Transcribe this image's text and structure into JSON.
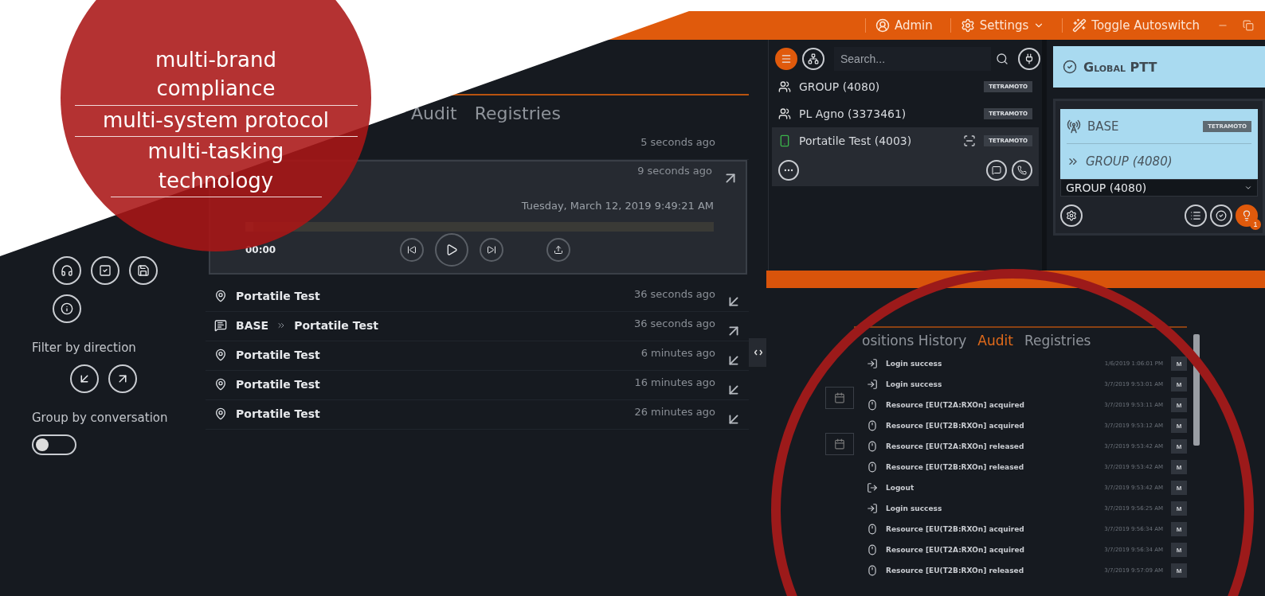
{
  "promo": {
    "lines": [
      "multi-brand\ncompliance",
      "multi-system protocol",
      "multi-tasking\ntechnology"
    ]
  },
  "title_bar": {
    "user": "Admin",
    "settings": "Settings",
    "autoswitch": "Toggle Autoswitch"
  },
  "left_panel": {
    "filter_label": "Filter by direction",
    "group_label": "Group by conversation",
    "group_toggle": {
      "on": false
    }
  },
  "history": {
    "tabs": [
      {
        "label": "Audit",
        "selected": false
      },
      {
        "label": "Registries",
        "selected": false
      }
    ],
    "events": [
      {
        "kind": "call",
        "time": "5 seconds ago"
      },
      {
        "kind": "call",
        "time": "9 seconds ago",
        "incoming": false,
        "player": {
          "date": "Tuesday, March 12, 2019 9:49:21 AM",
          "position": "00:00",
          "level": 0.0
        }
      },
      {
        "kind": "position",
        "target": "Portatile Test",
        "time": "36 seconds ago",
        "incoming": true
      },
      {
        "kind": "message",
        "source": "BASE",
        "target": "Portatile Test",
        "time": "36 seconds ago",
        "incoming": false
      },
      {
        "kind": "position",
        "target": "Portatile Test",
        "time": "6 minutes ago",
        "incoming": true
      },
      {
        "kind": "position",
        "target": "Portatile Test",
        "time": "16 minutes ago",
        "incoming": true
      },
      {
        "kind": "position",
        "target": "Portatile Test",
        "time": "26 minutes ago",
        "incoming": true
      }
    ]
  },
  "contacts": {
    "search": {
      "placeholder": "Search..."
    },
    "items": [
      {
        "kind": "group",
        "name": "GROUP (4080)",
        "tag": "TETRAMOTO",
        "selected": false
      },
      {
        "kind": "group",
        "name": "PL Agno (3373461)",
        "tag": "TETRAMOTO",
        "selected": false
      },
      {
        "kind": "radio",
        "name": "Portatile Test (4003)",
        "tag": "TETRAMOTO",
        "selected": true
      }
    ]
  },
  "ptt": {
    "global": "Global PTT",
    "station": "BASE",
    "tag": "TETRAMOTO",
    "target": "GROUP (4080)",
    "select_value": "GROUP (4080)",
    "badge": "1"
  },
  "audit": {
    "tabs": [
      {
        "label": "ositions History",
        "selected": false
      },
      {
        "label": "Audit",
        "selected": true
      },
      {
        "label": "Registries",
        "selected": false
      }
    ],
    "rows": [
      {
        "kind": "login",
        "text": "Login success",
        "time": "1/6/2019 1:06:01 PM",
        "action": "M"
      },
      {
        "kind": "login",
        "text": "Login success",
        "time": "3/7/2019 9:53:01 AM",
        "action": "M"
      },
      {
        "kind": "resource",
        "text": "Resource [EU(T2A:RXOn] acquired",
        "time": "3/7/2019 9:53:11 AM",
        "action": "M"
      },
      {
        "kind": "resource",
        "text": "Resource [EU(T2B:RXOn] acquired",
        "time": "3/7/2019 9:53:12 AM",
        "action": "M"
      },
      {
        "kind": "resource",
        "text": "Resource [EU(T2A:RXOn] released",
        "time": "3/7/2019 9:53:42 AM",
        "action": "M"
      },
      {
        "kind": "resource",
        "text": "Resource [EU(T2B:RXOn] released",
        "time": "3/7/2019 9:53:42 AM",
        "action": "M"
      },
      {
        "kind": "logout",
        "text": "Logout",
        "time": "3/7/2019 9:53:42 AM",
        "action": "M"
      },
      {
        "kind": "login",
        "text": "Login success",
        "time": "3/7/2019 9:56:25 AM",
        "action": "M"
      },
      {
        "kind": "resource",
        "text": "Resource [EU(T2B:RXOn] acquired",
        "time": "3/7/2019 9:56:34 AM",
        "action": "M"
      },
      {
        "kind": "resource",
        "text": "Resource [EU(T2A:RXOn] acquired",
        "time": "3/7/2019 9:56:34 AM",
        "action": "M"
      },
      {
        "kind": "resource",
        "text": "Resource [EU(T2B:RXOn] released",
        "time": "3/7/2019 9:57:09 AM",
        "action": "M"
      }
    ]
  }
}
